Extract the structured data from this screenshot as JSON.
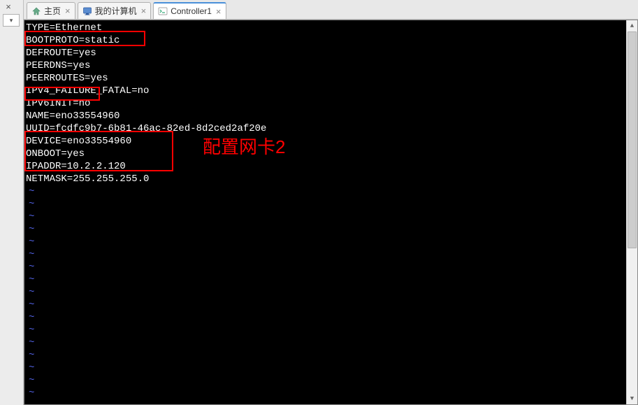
{
  "left_panel": {
    "close_glyph": "×",
    "dropdown_glyph": "▾"
  },
  "tabs": [
    {
      "label": "主页",
      "icon": "home-icon",
      "closable": true,
      "active": false
    },
    {
      "label": "我的计算机",
      "icon": "monitor-icon",
      "closable": true,
      "active": false
    },
    {
      "label": "Controller1",
      "icon": "terminal-icon",
      "closable": true,
      "active": true
    }
  ],
  "terminal": {
    "lines": [
      "TYPE=Ethernet",
      "BOOTPROTO=static",
      "DEFROUTE=yes",
      "PEERDNS=yes",
      "PEERROUTES=yes",
      "IPV4_FAILURE_FATAL=no",
      "IPV6INIT=no",
      "NAME=eno33554960",
      "UUID=fcdfc9b7-6b81-46ac-82ed-8d2ced2af20e",
      "DEVICE=eno33554960",
      "ONBOOT=yes",
      "IPADDR=10.2.2.120",
      "NETMASK=255.255.255.0"
    ],
    "tilde_rows": 17,
    "tilde_char": "~"
  },
  "annotation": "配置网卡2",
  "highlights": [
    {
      "id": "hl1",
      "covers": "BOOTPROTO=static"
    },
    {
      "id": "hl2",
      "covers": "IPV6INIT=no"
    },
    {
      "id": "hl3",
      "covers": "ONBOOT/IPADDR/NETMASK"
    }
  ],
  "colors": {
    "terminal_bg": "#000000",
    "terminal_fg": "#ffffff",
    "highlight_border": "#ff0000",
    "annotation_color": "#ff0000",
    "tilde_color": "#5060e0",
    "tab_active_accent": "#4a90d9"
  }
}
